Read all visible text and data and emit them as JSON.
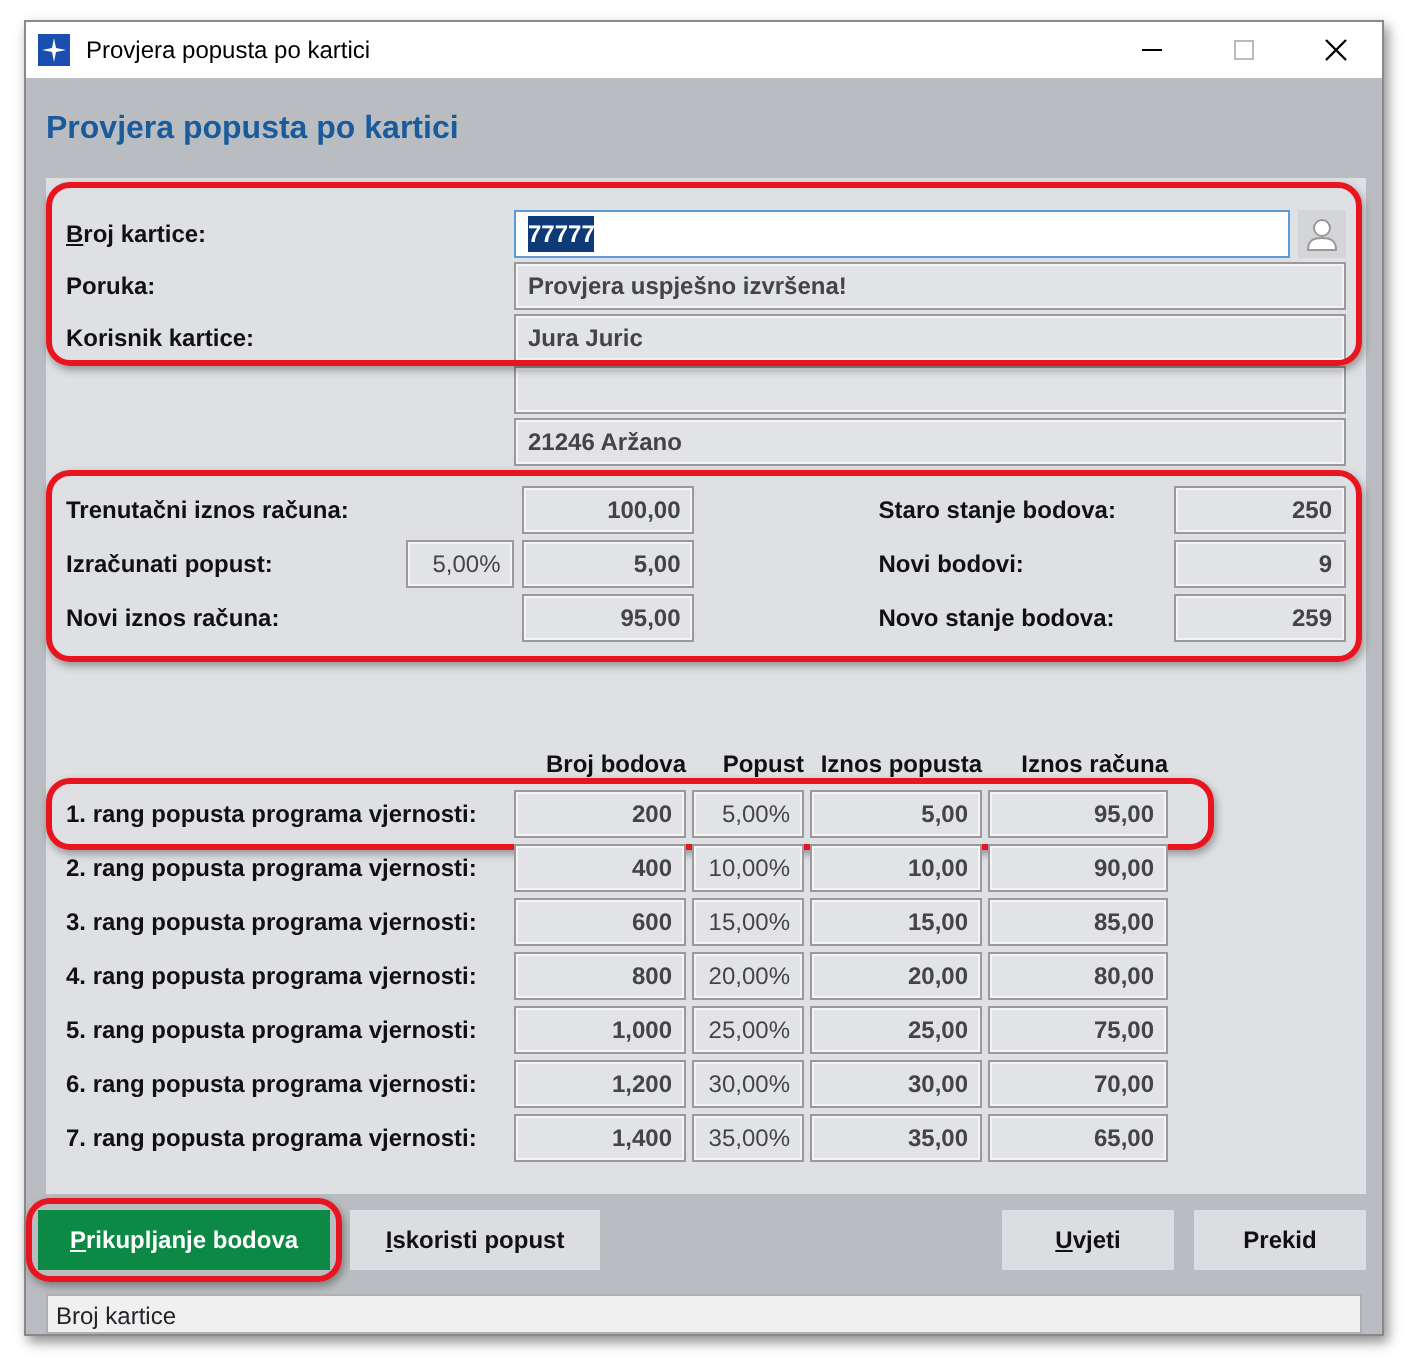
{
  "window": {
    "title": "Provjera popusta po kartici"
  },
  "header": "Provjera popusta po kartici",
  "card": {
    "fields": [
      {
        "label": "Broj kartice:",
        "mnemonic": true,
        "kind": "input",
        "value": "77777",
        "text_selected": true,
        "highlight": true
      },
      {
        "label": "Poruka:",
        "mnemonic": false,
        "kind": "display",
        "value": "Provjera uspješno izvršena!",
        "highlight": true
      },
      {
        "label": "Korisnik kartice:",
        "mnemonic": false,
        "kind": "display",
        "value": "Jura Juric",
        "highlight": true
      },
      {
        "kind": "display",
        "highlight": false
      },
      {
        "kind": "display",
        "value": "21246 Aržano",
        "highlight": false
      }
    ]
  },
  "totals": {
    "highlight": true,
    "left": [
      {
        "label": "Trenutačni iznos računa:",
        "value": "100,00"
      },
      {
        "label": "Izračunati popust:",
        "percent": "5,00%",
        "value": "5,00"
      },
      {
        "label": "Novi iznos računa:",
        "value": "95,00"
      }
    ],
    "right": [
      {
        "label": "Staro stanje bodova:",
        "value": "250"
      },
      {
        "label": "Novi bodovi:",
        "value": "9"
      },
      {
        "label": "Novo stanje bodova:",
        "value": "259"
      }
    ]
  },
  "ranks": {
    "columns": [
      "Broj bodova",
      "Popust",
      "Iznos popusta",
      "Iznos računa"
    ],
    "rows": [
      {
        "label": "1. rang popusta programa vjernosti:",
        "highlight": true,
        "cells": [
          "200",
          "5,00%",
          "5,00",
          "95,00"
        ]
      },
      {
        "label": "2. rang popusta programa vjernosti:",
        "highlight": false,
        "cells": [
          "400",
          "10,00%",
          "10,00",
          "90,00"
        ]
      },
      {
        "label": "3. rang popusta programa vjernosti:",
        "highlight": false,
        "cells": [
          "600",
          "15,00%",
          "15,00",
          "85,00"
        ]
      },
      {
        "label": "4. rang popusta programa vjernosti:",
        "highlight": false,
        "cells": [
          "800",
          "20,00%",
          "20,00",
          "80,00"
        ]
      },
      {
        "label": "5. rang popusta programa vjernosti:",
        "highlight": false,
        "cells": [
          "1,000",
          "25,00%",
          "25,00",
          "75,00"
        ]
      },
      {
        "label": "6. rang popusta programa vjernosti:",
        "highlight": false,
        "cells": [
          "1,200",
          "30,00%",
          "30,00",
          "70,00"
        ]
      },
      {
        "label": "7. rang popusta programa vjernosti:",
        "highlight": false,
        "cells": [
          "1,400",
          "35,00%",
          "35,00",
          "65,00"
        ]
      }
    ]
  },
  "buttons_left": [
    {
      "label": "Prikupljanje bodova",
      "mnemonic": true,
      "primary": true,
      "highlight": true
    },
    {
      "label": "Iskoristi popust",
      "mnemonic": true,
      "primary": false,
      "highlight": false
    }
  ],
  "buttons_right": [
    {
      "label": "Uvjeti",
      "mnemonic": true,
      "primary": false,
      "highlight": false
    },
    {
      "label": "Prekid",
      "mnemonic": false,
      "primary": false,
      "highlight": false
    }
  ],
  "status_bar": "Broj kartice"
}
